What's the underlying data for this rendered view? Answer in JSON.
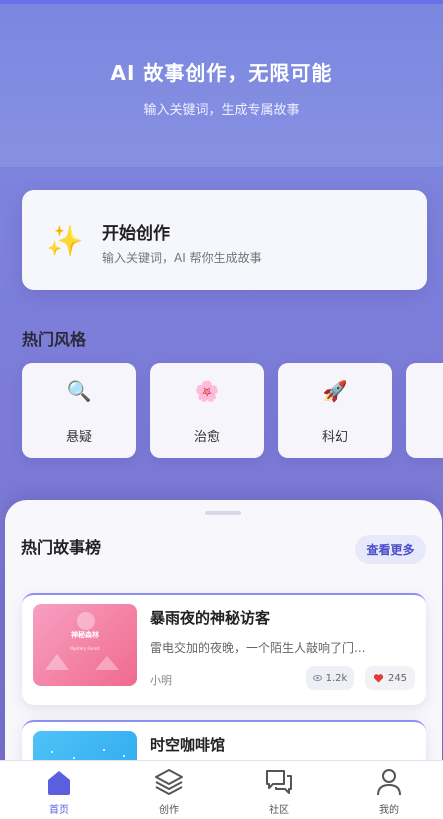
{
  "hero": {
    "title": "AI 故事创作，无限可能",
    "subtitle": "输入关键词，生成专属故事"
  },
  "create_card": {
    "icon": "✨",
    "title": "开始创作",
    "subtitle": "输入关键词，AI 帮你生成故事"
  },
  "hot_styles": {
    "title": "热门风格",
    "items": [
      {
        "icon": "🔍",
        "label": "悬疑"
      },
      {
        "icon": "🌸",
        "label": "治愈"
      },
      {
        "icon": "🚀",
        "label": "科幻"
      }
    ]
  },
  "ranking": {
    "title": "热门故事榜",
    "more_label": "查看更多",
    "stories": [
      {
        "title": "暴雨夜的神秘访客",
        "desc": "雷电交加的夜晚，一个陌生人敲响了门...",
        "author": "小明",
        "views": "1.2k",
        "likes": "245",
        "cover_title": "神秘森林",
        "cover_subtitle": "Mystery Forest"
      },
      {
        "title": "时空咖啡馆"
      }
    ]
  },
  "tabbar": {
    "items": [
      {
        "label": "首页",
        "icon": "home-icon"
      },
      {
        "label": "创作",
        "icon": "layers-icon"
      },
      {
        "label": "社区",
        "icon": "chat-icon"
      },
      {
        "label": "我的",
        "icon": "user-icon"
      }
    ]
  },
  "colors": {
    "accent": "#5a5fe0",
    "like": "#e53935"
  }
}
